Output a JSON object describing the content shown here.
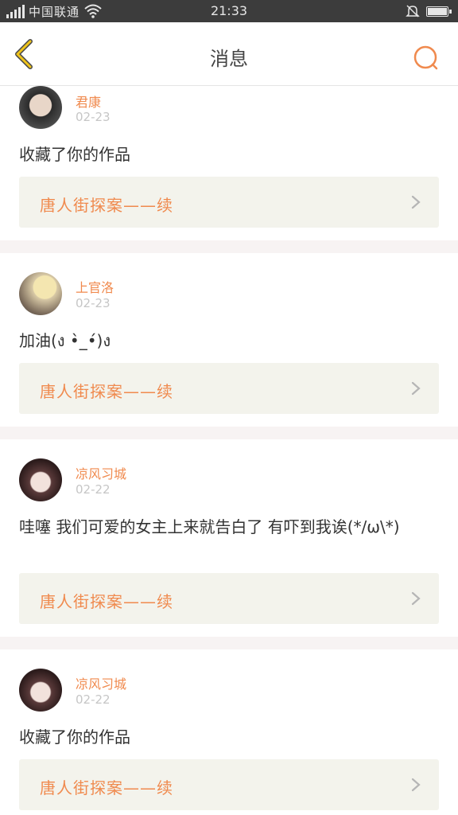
{
  "status_bar": {
    "carrier": "中国联通",
    "time": "21:33"
  },
  "nav": {
    "title": "消息",
    "back_icon": "chevron-left-icon",
    "search_icon": "search-icon",
    "accent_color": "#f0c419"
  },
  "messages": [
    {
      "username": "君康",
      "date": "02-23",
      "text": "收藏了你的作品",
      "work_title": "唐人街探案——续"
    },
    {
      "username": "上官洛",
      "date": "02-23",
      "text": "加油(ง •̀_•́)ง",
      "work_title": "唐人街探案——续"
    },
    {
      "username": "凉风习城",
      "date": "02-22",
      "text": "哇噻 我们可爱的女主上来就告白了 有吓到我诶(*/ω\\*)",
      "work_title": "唐人街探案——续"
    },
    {
      "username": "凉风习城",
      "date": "02-22",
      "text": "收藏了你的作品",
      "work_title": "唐人街探案——续"
    }
  ],
  "colors": {
    "username": "#f08a4e",
    "work_bg": "#f3f3ec",
    "separator": "#f7f3f3"
  }
}
